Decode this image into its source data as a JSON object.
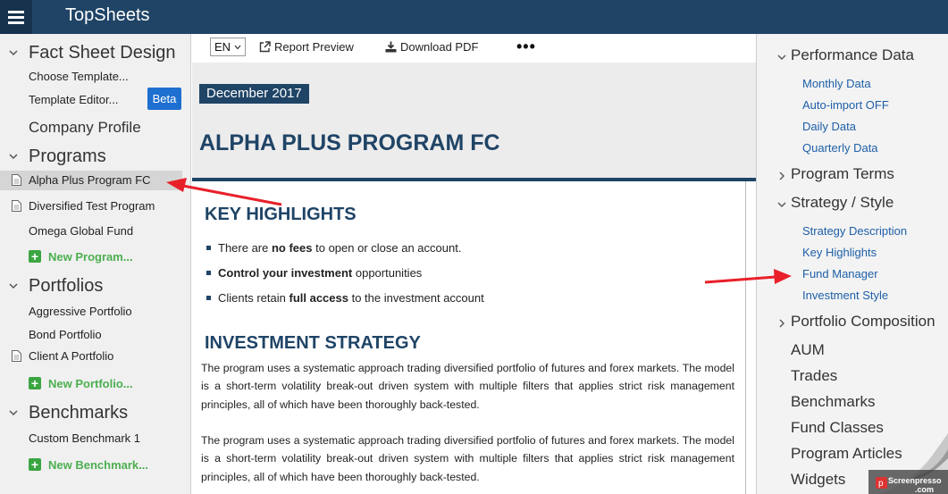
{
  "app": {
    "title": "TopSheets"
  },
  "left": {
    "sections": {
      "fact_sheet_design": "Fact Sheet Design",
      "programs": "Programs",
      "portfolios": "Portfolios",
      "benchmarks": "Benchmarks"
    },
    "fact_sheet_items": {
      "choose_template": "Choose Template...",
      "template_editor": "Template Editor...",
      "beta": "Beta"
    },
    "company_profile": "Company Profile",
    "programs": [
      "Alpha Plus Program FC",
      "Diversified Test Program",
      "Omega Global Fund"
    ],
    "new_program": "New Program...",
    "portfolios": [
      "Aggressive Portfolio",
      "Bond Portfolio",
      "Client A Portfolio"
    ],
    "new_portfolio": "New Portfolio...",
    "benchmarks": [
      "Custom Benchmark 1"
    ],
    "new_benchmark": "New Benchmark..."
  },
  "toolbar": {
    "lang": "EN",
    "report_preview": "Report Preview",
    "download_pdf": "Download PDF",
    "more": "•••"
  },
  "document": {
    "date": "December 2017",
    "title": "ALPHA PLUS PROGRAM FC",
    "key_highlights_heading": "KEY HIGHLIGHTS",
    "highlights": [
      {
        "pre": "There are ",
        "bold": "no fees",
        "post": " to open or close an account."
      },
      {
        "pre": "",
        "bold": "Control your investment",
        "post": " opportunities"
      },
      {
        "pre": "Clients retain ",
        "bold": "full access",
        "post": " to the investment account"
      }
    ],
    "strategy_heading": "INVESTMENT STRATEGY",
    "paragraphs": [
      "The program uses a systematic approach trading diversified portfolio of futures and forex markets. The model is a short-term volatility break-out driven system with multiple filters that applies strict risk management principles, all of which have been thoroughly back-tested.",
      "The program uses a systematic approach trading diversified portfolio of futures and forex markets. The model is a short-term volatility break-out driven system with multiple filters that applies strict risk management principles, all of which have been thoroughly back-tested."
    ]
  },
  "right": {
    "performance_data": "Performance Data",
    "performance_items": [
      "Monthly Data",
      "Auto-import OFF",
      "Daily Data",
      "Quarterly Data"
    ],
    "program_terms": "Program Terms",
    "strategy_style": "Strategy / Style",
    "strategy_items": [
      "Strategy Description",
      "Key Highlights",
      "Fund Manager",
      "Investment Style"
    ],
    "portfolio_composition": "Portfolio Composition",
    "plain_items": [
      "AUM",
      "Trades",
      "Benchmarks",
      "Fund Classes",
      "Program Articles",
      "Widgets"
    ]
  },
  "watermark": {
    "text": "Screenpresso",
    "sub": ".com"
  },
  "colors": {
    "header": "#1f4466",
    "link": "#1e5fa8",
    "green": "#3aa541",
    "beta": "#1e6fd0",
    "arrow": "#e8202a"
  }
}
